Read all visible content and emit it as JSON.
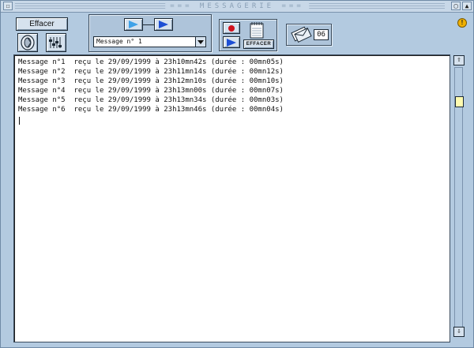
{
  "window": {
    "title": "=== MESSAGERIE ===",
    "close_glyph": "☐",
    "zoom_glyph": "▢",
    "collapse_glyph": "▲",
    "info_glyph": "!"
  },
  "toolbar": {
    "effacer_label": "Effacer",
    "effacer_small_label": "EFFACER",
    "message_select": {
      "selected": "Message n° 1"
    },
    "counter": "06"
  },
  "log": {
    "lines": [
      "Message n°1  reçu le 29/09/1999 à 23h10mn42s (durée : 00mn05s)",
      "Message n°2  reçu le 29/09/1999 à 23h11mn14s (durée : 00mn12s)",
      "Message n°3  reçu le 29/09/1999 à 23h12mn10s (durée : 00mn10s)",
      "Message n°4  reçu le 29/09/1999 à 23h13mn00s (durée : 00mn07s)",
      "Message n°5  reçu le 29/09/1999 à 23h13mn34s (durée : 00mn03s)",
      "Message n°6  reçu le 29/09/1999 à 23h13mn46s (durée : 00mn04s)"
    ]
  },
  "scrollbar": {
    "up_glyph": "⇧",
    "down_glyph": "⇩",
    "position": 0.1
  },
  "icons": {
    "record": "record-icon",
    "play": "play-icon",
    "speaker": "speaker-icon",
    "equalizer": "equalizer-icon",
    "notepad": "notepad-icon",
    "envelopes": "envelopes-icon"
  },
  "colors": {
    "record": "#d0101c",
    "play": "#1d4fd4",
    "thumb": "#fffbb0",
    "info": "#f0b000"
  }
}
